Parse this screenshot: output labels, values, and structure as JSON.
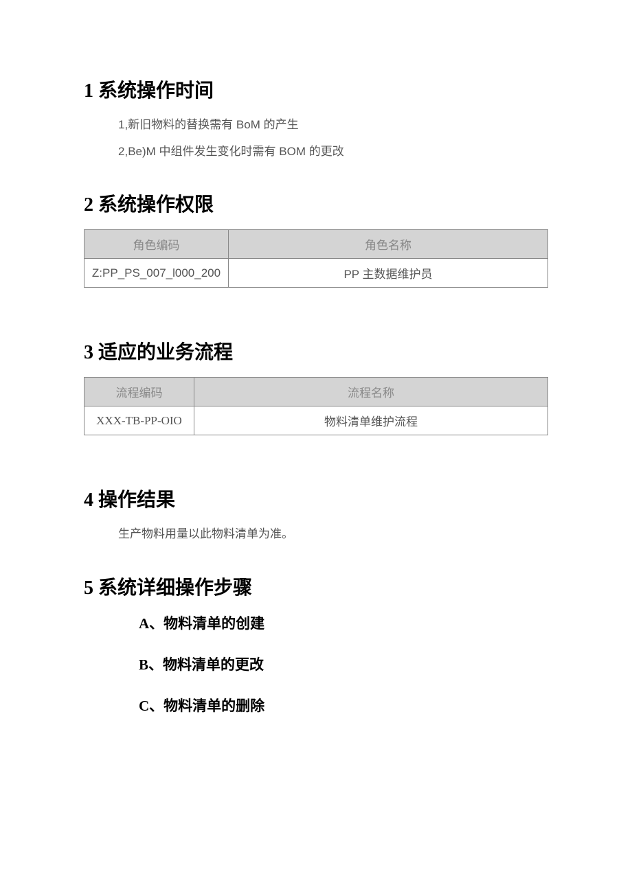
{
  "section1": {
    "heading_num": "1",
    "heading_text": "系统操作时间",
    "line1_prefix": "1,",
    "line1_a": "新旧物料的替换需有",
    "line1_latin": " BoM ",
    "line1_b": "的产生",
    "line2_prefix": "2,",
    "line2_latin1": "Be)M ",
    "line2_a": "中组件发生变化时需有",
    "line2_latin2": " BOM ",
    "line2_b": "的更改"
  },
  "section2": {
    "heading_num": "2",
    "heading_text": "系统操作权限",
    "header_col1": "角色编码",
    "header_col2": "角色名称",
    "row1_col1": "Z:PP_PS_007_l000_200",
    "row1_col2_latin": "PP ",
    "row1_col2_cn": "主数据维护员"
  },
  "section3": {
    "heading_num": "3",
    "heading_text": "适应的业务流程",
    "header_col1": "流程编码",
    "header_col2": "流程名称",
    "row1_col1": "XXX-TB-PP-OIO",
    "row1_col2": "物料清单维护流程"
  },
  "section4": {
    "heading_num": "4",
    "heading_text": "操作结果",
    "body": "生产物料用量以此物料清单为准。"
  },
  "section5": {
    "heading_num": "5",
    "heading_text": "系统详细操作步骤",
    "itemA_letter": "A、",
    "itemA_text": "物料清单的创建",
    "itemB_letter": "B、",
    "itemB_text": "物料清单的更改",
    "itemC_letter": "C、",
    "itemC_text": "物料清单的删除"
  }
}
